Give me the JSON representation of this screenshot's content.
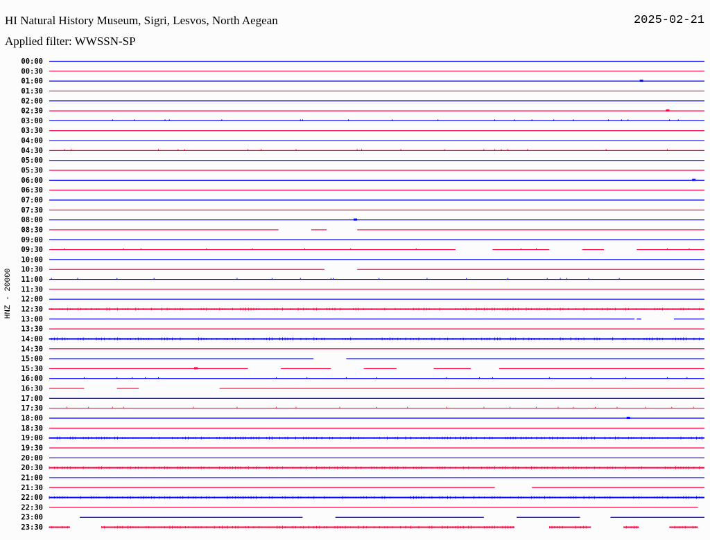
{
  "header": {
    "title": "HI Natural History Museum, Sigri, Lesvos, North Aegean",
    "filter": "Applied filter: WWSSN-SP",
    "date": "2025-02-21"
  },
  "chart_data": {
    "type": "line",
    "subtype": "helicorder",
    "ylabel": "HNZ - 20000",
    "row_minutes": 30,
    "colors": {
      "even": "#0000ff",
      "odd": "#ff0040"
    },
    "rows": [
      {
        "label": "00:00"
      },
      {
        "label": "00:30"
      },
      {
        "label": "01:00",
        "events": [
          27.1
        ]
      },
      {
        "label": "01:30"
      },
      {
        "label": "02:00"
      },
      {
        "label": "02:30",
        "events": [
          28.3
        ]
      },
      {
        "label": "03:00",
        "ticks": [
          2.9,
          3.9,
          5.3,
          5.5,
          7.9,
          11.5,
          11.6,
          13.7,
          15.7,
          17.8,
          20.4,
          21.3,
          22.1,
          23.1,
          24.0,
          25.6,
          26.2,
          26.5,
          28.4,
          28.8
        ]
      },
      {
        "label": "03:30"
      },
      {
        "label": "04:00"
      },
      {
        "label": "04:30",
        "ticks": [
          0.7,
          1.0,
          5.0,
          5.9,
          6.2,
          9.1,
          9.7,
          11.3,
          14.1,
          14.3,
          16.1,
          18.1,
          19.9,
          20.4,
          20.7,
          21.0,
          21.9,
          25.5,
          28.3
        ]
      },
      {
        "label": "05:00"
      },
      {
        "label": "05:30"
      },
      {
        "label": "06:00",
        "events": [
          29.5
        ]
      },
      {
        "label": "06:30"
      },
      {
        "label": "07:00"
      },
      {
        "label": "07:30"
      },
      {
        "label": "08:00",
        "events": [
          14.0
        ]
      },
      {
        "label": "08:30",
        "segments": [
          [
            0,
            10.5
          ],
          [
            12.0,
            12.7
          ],
          [
            14.1,
            30
          ]
        ]
      },
      {
        "label": "09:00"
      },
      {
        "label": "09:30",
        "segments": [
          [
            0,
            18.6
          ],
          [
            20.3,
            22.9
          ],
          [
            24.4,
            25.4
          ],
          [
            26.9,
            30
          ]
        ],
        "ticks": [
          0.7,
          3.4,
          4.2,
          7.2,
          9.3,
          11.7,
          13.8,
          16.8,
          21.6,
          22.3,
          28.3,
          29.3
        ]
      },
      {
        "label": "10:00"
      },
      {
        "label": "10:30",
        "segments": [
          [
            0,
            12.6
          ],
          [
            14.1,
            30
          ]
        ]
      },
      {
        "label": "11:00",
        "ticks": [
          0.1,
          1.3,
          3.1,
          4.8,
          8.6,
          10.2,
          11.5,
          12.9,
          13.0,
          15.1,
          17.3,
          19.1,
          21.0,
          22.8,
          23.4,
          23.7,
          24.7,
          26.1
        ]
      },
      {
        "label": "11:30"
      },
      {
        "label": "12:00"
      },
      {
        "label": "12:30",
        "noise": true
      },
      {
        "label": "13:00",
        "segments": [
          [
            0,
            26.8
          ],
          [
            26.9,
            27.1
          ],
          [
            28.6,
            30
          ]
        ]
      },
      {
        "label": "13:30"
      },
      {
        "label": "14:00",
        "noise": true
      },
      {
        "label": "14:30"
      },
      {
        "label": "15:00",
        "segments": [
          [
            0,
            12.1
          ],
          [
            13.6,
            30
          ]
        ]
      },
      {
        "label": "15:30",
        "segments": [
          [
            0,
            9.1
          ],
          [
            10.6,
            12.9
          ],
          [
            14.4,
            15.9
          ],
          [
            17.6,
            19.3
          ],
          [
            20.6,
            30
          ]
        ],
        "events": [
          6.7
        ]
      },
      {
        "label": "16:00",
        "ticks": [
          1.6,
          3.1,
          3.8,
          4.4,
          5.0,
          10.4,
          11.8,
          13.6,
          15.0,
          18.2,
          19.7,
          20.3,
          22.9,
          24.8,
          26.4,
          28.3,
          29.2
        ]
      },
      {
        "label": "16:30",
        "segments": [
          [
            0,
            1.6
          ],
          [
            3.1,
            4.1
          ],
          [
            7.8,
            30
          ]
        ]
      },
      {
        "label": "17:00"
      },
      {
        "label": "17:30",
        "ticks": [
          0.8,
          1.8,
          2.9,
          3.4,
          6.6,
          8.6,
          10.4,
          11.3,
          13.3,
          15.0,
          16.4,
          18.2,
          19.9,
          21.1,
          22.3,
          23.3,
          24.0,
          25.0,
          26.0,
          27.3,
          28.5,
          29.5
        ]
      },
      {
        "label": "18:00",
        "events": [
          26.5
        ]
      },
      {
        "label": "18:30"
      },
      {
        "label": "19:00",
        "noise": true
      },
      {
        "label": "19:30"
      },
      {
        "label": "20:00"
      },
      {
        "label": "20:30",
        "noise": true
      },
      {
        "label": "21:00"
      },
      {
        "label": "21:30",
        "segments": [
          [
            0,
            20.4
          ],
          [
            22.1,
            30
          ]
        ]
      },
      {
        "label": "22:00",
        "noise": true
      },
      {
        "label": "22:30",
        "segments": [
          [
            0,
            29.7
          ]
        ]
      },
      {
        "label": "23:00",
        "segments": [
          [
            1.4,
            11.6
          ],
          [
            13.1,
            19.9
          ],
          [
            21.4,
            24.3
          ],
          [
            25.7,
            30
          ]
        ]
      },
      {
        "label": "23:30",
        "noise": true,
        "segments": [
          [
            0,
            0.95
          ],
          [
            2.4,
            21.3
          ],
          [
            22.9,
            24.8
          ],
          [
            26.3,
            27.0
          ],
          [
            28.4,
            29.7
          ]
        ]
      }
    ]
  }
}
